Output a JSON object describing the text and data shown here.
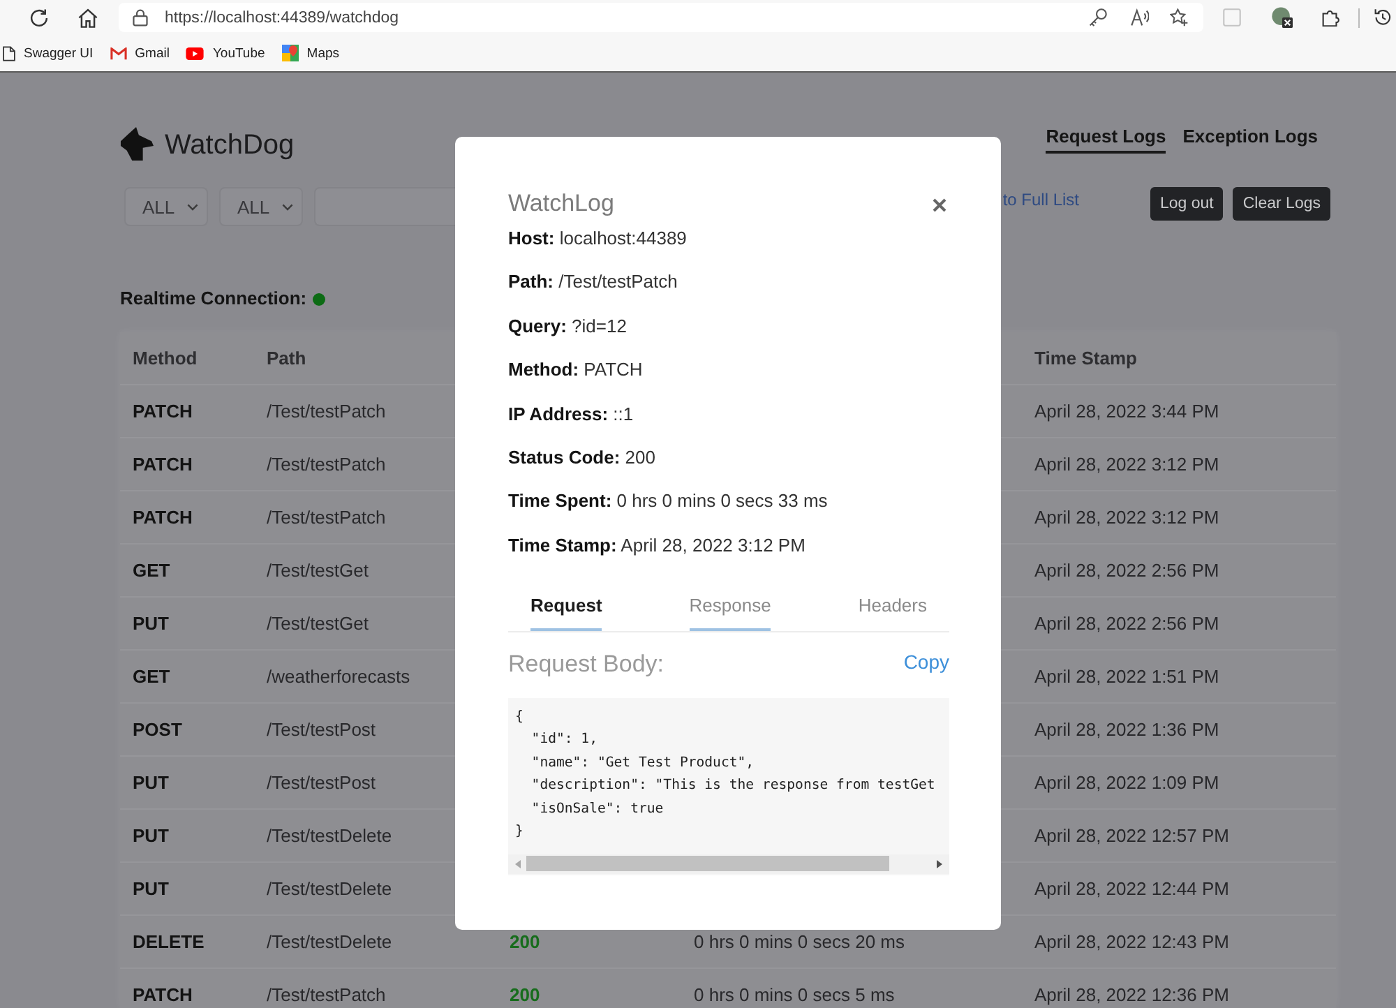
{
  "browser": {
    "url": "https://localhost:44389/watchdog",
    "bookmarks": [
      {
        "kind": "page",
        "label": "Swagger UI"
      },
      {
        "kind": "mail",
        "label": "Gmail"
      },
      {
        "kind": "video",
        "label": "YouTube"
      },
      {
        "kind": "map",
        "label": "Maps"
      }
    ]
  },
  "app": {
    "title": "WatchDog",
    "nav": [
      {
        "label": "Request Logs",
        "selected": true
      },
      {
        "label": "Exception Logs",
        "selected": false
      }
    ],
    "filters": [
      {
        "value": "ALL"
      },
      {
        "value": "ALL"
      }
    ],
    "back_link": "to Full List",
    "buttons": [
      "Log out",
      "Clear Logs"
    ],
    "realtime": {
      "label": "Realtime Connection:",
      "connected": true
    }
  },
  "table": {
    "columns": {
      "method": "Method",
      "path": "Path",
      "time_stamp": "Time Stamp"
    },
    "rows": [
      {
        "method": "PATCH",
        "path": "/Test/testPatch",
        "time_stamp": "April 28, 2022 3:44 PM"
      },
      {
        "method": "PATCH",
        "path": "/Test/testPatch",
        "time_stamp": "April 28, 2022 3:12 PM"
      },
      {
        "method": "PATCH",
        "path": "/Test/testPatch",
        "time_stamp": "April 28, 2022 3:12 PM"
      },
      {
        "method": "GET",
        "path": "/Test/testGet",
        "time_stamp": "April 28, 2022 2:56 PM"
      },
      {
        "method": "PUT",
        "path": "/Test/testGet",
        "time_stamp": "April 28, 2022 2:56 PM"
      },
      {
        "method": "GET",
        "path": "/weatherforecasts",
        "time_stamp": "April 28, 2022 1:51 PM"
      },
      {
        "method": "POST",
        "path": "/Test/testPost",
        "time_stamp": "April 28, 2022 1:36 PM"
      },
      {
        "method": "PUT",
        "path": "/Test/testPost",
        "time_stamp": "April 28, 2022 1:09 PM"
      },
      {
        "method": "PUT",
        "path": "/Test/testDelete",
        "time_stamp": "April 28, 2022 12:57 PM"
      },
      {
        "method": "PUT",
        "path": "/Test/testDelete",
        "time_stamp": "April 28, 2022 12:44 PM"
      },
      {
        "method": "DELETE",
        "path": "/Test/testDelete",
        "column_3": "200",
        "column_4": "0 hrs 0 mins 0 secs 20 ms",
        "time_stamp": "April 28, 2022 12:43 PM"
      },
      {
        "method": "PATCH",
        "path": "/Test/testPatch",
        "column_3": "200",
        "column_4": "0 hrs 0 mins 0 secs 5 ms",
        "time_stamp": "April 28, 2022 12:36 PM"
      }
    ]
  },
  "modal": {
    "title": "WatchLog",
    "fields": [
      {
        "label": "Host:",
        "value": "localhost:44389"
      },
      {
        "label": "Path:",
        "value": "/Test/testPatch"
      },
      {
        "label": "Query:",
        "value": "?id=12"
      },
      {
        "label": "Method:",
        "value": "PATCH"
      },
      {
        "label": "IP Address:",
        "value": "::1"
      },
      {
        "label": "Status Code:",
        "value": "200"
      },
      {
        "label": "Time Spent:",
        "value": "0 hrs 0 mins 0 secs 33 ms"
      },
      {
        "label": "Time Stamp:",
        "value": "April 28, 2022 3:12 PM"
      }
    ],
    "tabs": [
      {
        "label": "Request",
        "selected": true,
        "underlined": true
      },
      {
        "label": "Response",
        "selected": false,
        "underlined": true
      },
      {
        "label": "Headers",
        "selected": false,
        "underlined": false
      }
    ],
    "body_label": "Request Body:",
    "copy": "Copy",
    "code": "{\n  \"id\": 1,\n  \"name\": \"Get Test Product\",\n  \"description\": \"This is the response from testGet\n  \"isOnSale\": true\n}"
  }
}
